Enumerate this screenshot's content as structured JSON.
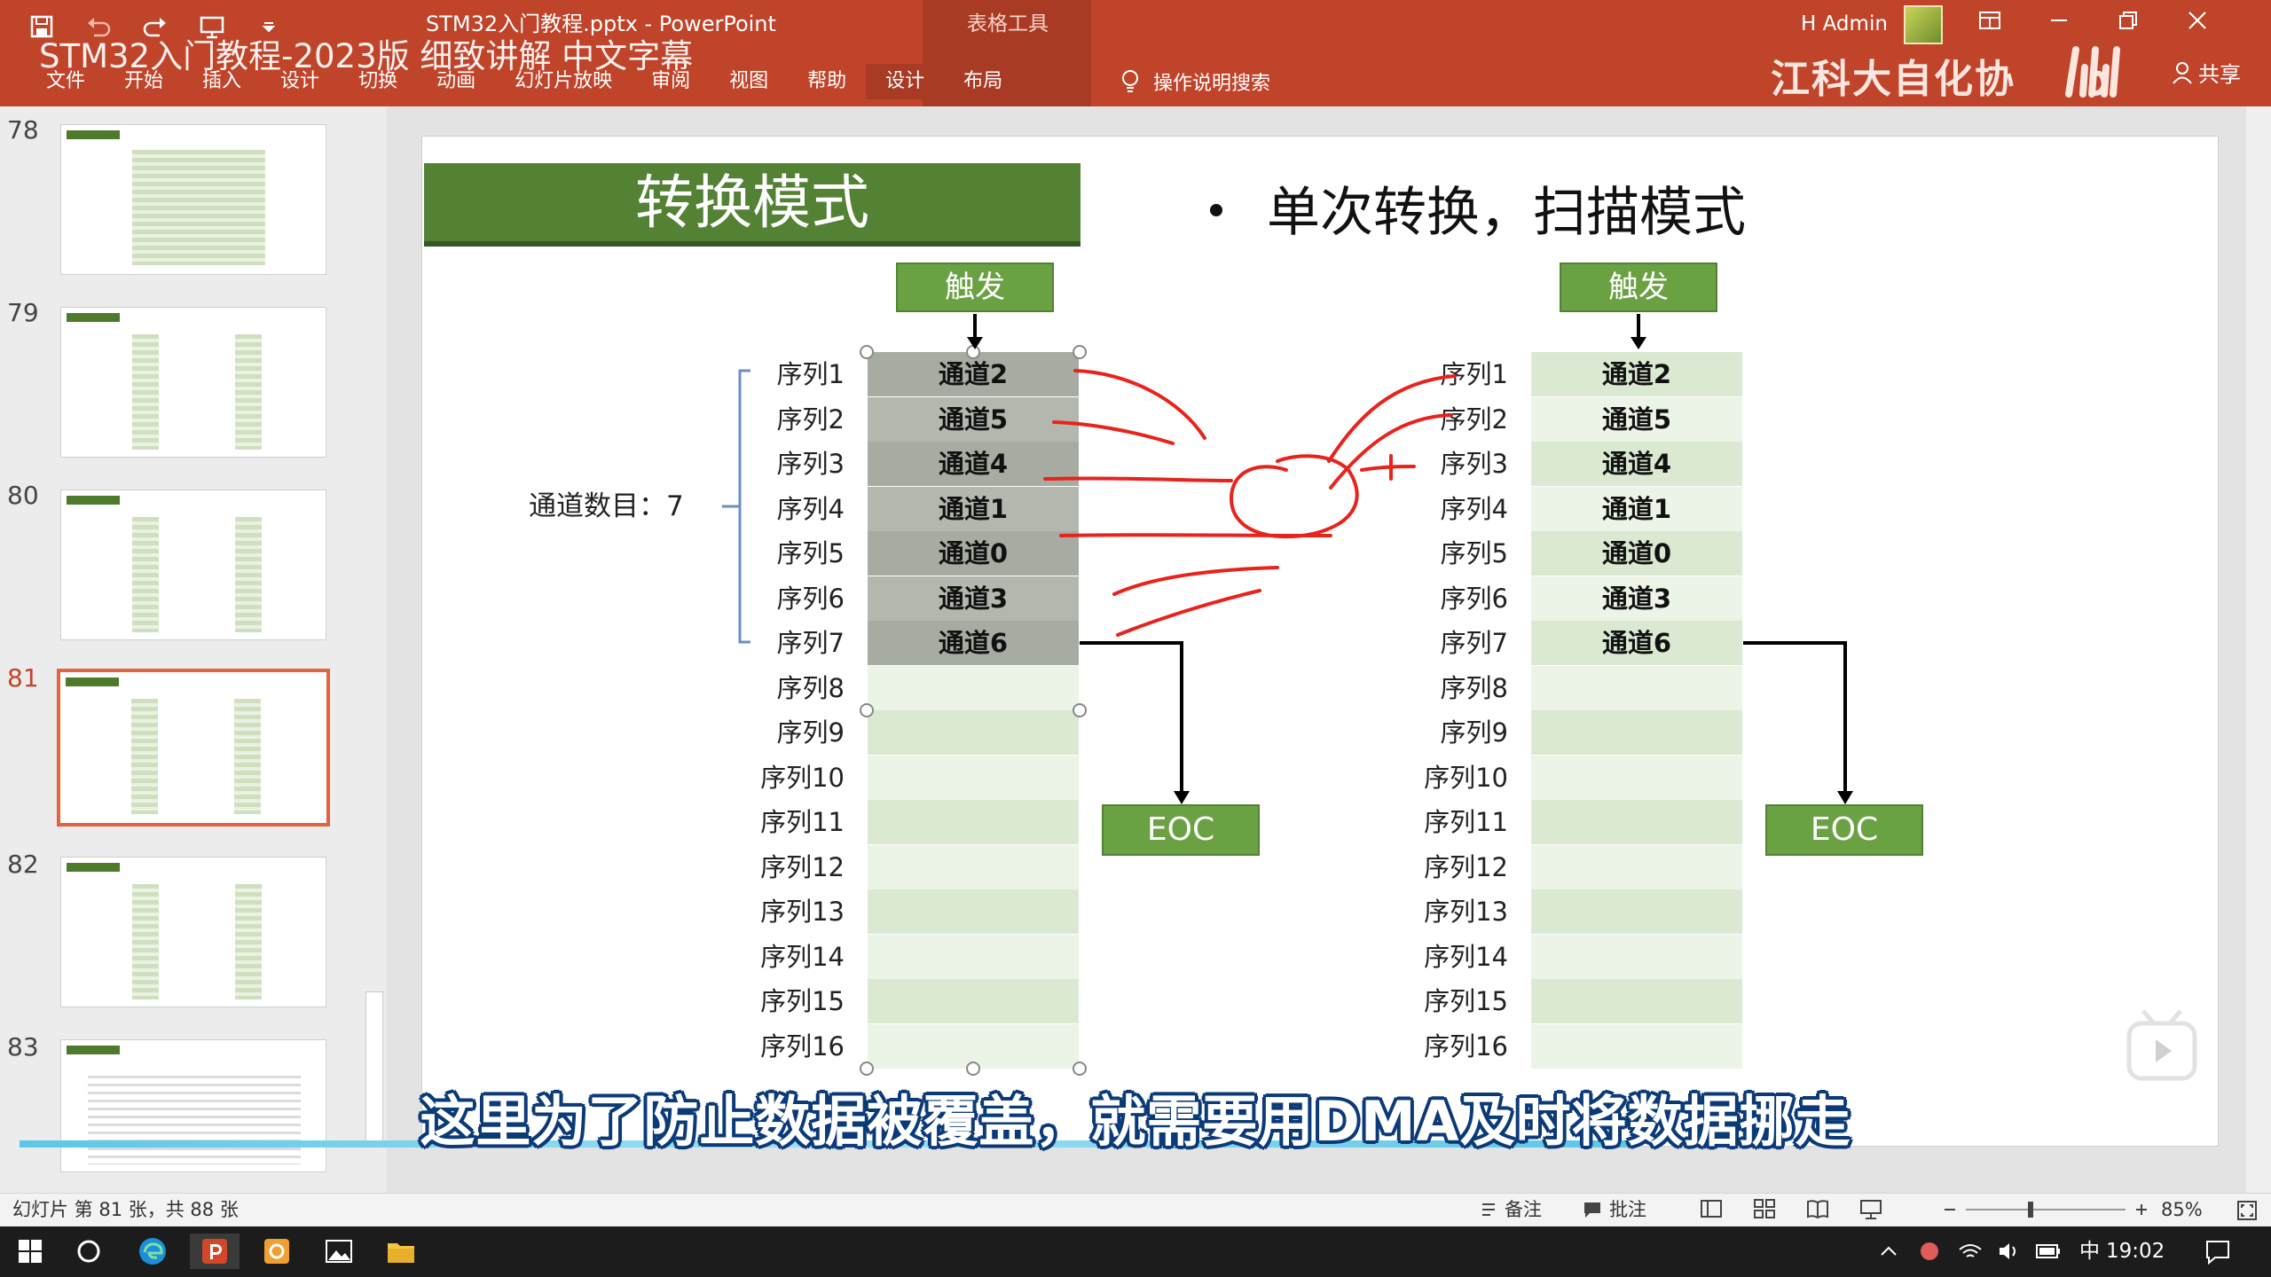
{
  "window": {
    "doc_title": "STM32入门教程.pptx  -  PowerPoint",
    "context_tools": "表格工具",
    "user": "H Admin"
  },
  "video_overlay": {
    "title": "STM32入门教程-2023版 细致讲解 中文字幕",
    "brand": "江科大自化协",
    "subtitle": "这里为了防止数据被覆盖，就需要用DMA及时将数据挪走"
  },
  "ribbon": {
    "tabs": [
      "文件",
      "开始",
      "插入",
      "设计",
      "切换",
      "动画",
      "幻灯片放映",
      "审阅",
      "视图",
      "帮助",
      "设计",
      "布局"
    ],
    "tell_me": "操作说明搜索",
    "share": "共享"
  },
  "thumbnails": {
    "numbers": [
      "78",
      "79",
      "80",
      "81",
      "82",
      "83"
    ],
    "active": "81"
  },
  "slide": {
    "title": "转换模式",
    "bullet": "单次转换，扫描模式",
    "channel_count_label": "通道数目：7",
    "trigger_label": "触发",
    "eoc_label": "EOC",
    "sequence_labels": [
      "序列1",
      "序列2",
      "序列3",
      "序列4",
      "序列5",
      "序列6",
      "序列7",
      "序列8",
      "序列9",
      "序列10",
      "序列11",
      "序列12",
      "序列13",
      "序列14",
      "序列15",
      "序列16"
    ],
    "channels": [
      "通道2",
      "通道5",
      "通道4",
      "通道1",
      "通道0",
      "通道3",
      "通道6",
      "",
      "",
      "",
      "",
      "",
      "",
      "",
      "",
      ""
    ]
  },
  "status": {
    "slide_info": "幻灯片 第 81 张，共 88 张",
    "notes": "备注",
    "comments": "批注",
    "zoom": "85%"
  },
  "taskbar": {
    "ime": "中",
    "time": "19:02"
  },
  "colors": {
    "ribbon": "#c0442a",
    "title_green": "#548235",
    "annotation_red": "#e8231c"
  }
}
